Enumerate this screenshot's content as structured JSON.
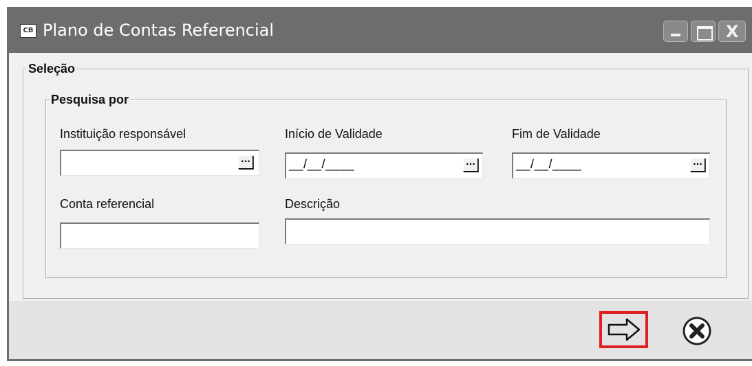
{
  "window": {
    "icon_text": "CB",
    "title": "Plano de Contas Referencial",
    "controls": {
      "minimize": "minimize",
      "maximize": "maximize",
      "close": "X"
    }
  },
  "selecao": {
    "legend": "Seleção",
    "pesquisa": {
      "legend": "Pesquisa por",
      "instituicao": {
        "label": "Instituição responsável",
        "value": "",
        "button": "..."
      },
      "inicio": {
        "label": "Início de Validade",
        "value": "__/__/____",
        "button": "..."
      },
      "fim": {
        "label": "Fim de Validade",
        "value": "__/__/____",
        "button": "..."
      },
      "conta": {
        "label": "Conta referencial",
        "value": ""
      },
      "descricao": {
        "label": "Descrição",
        "value": ""
      }
    }
  },
  "actions": {
    "confirm": {
      "icon": "arrow-right-icon"
    },
    "cancel": {
      "icon": "close-circle-icon"
    }
  }
}
